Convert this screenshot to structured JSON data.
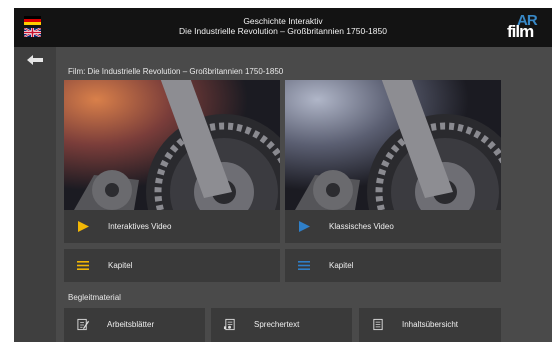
{
  "header": {
    "title_line1": "Geschichte Interaktiv",
    "title_line2": "Die Industrielle Revolution – Großbritannien 1750-1850",
    "logo_text": "film",
    "logo_overlay": "AR"
  },
  "languages": [
    {
      "name": "German",
      "icon": "german-flag-icon"
    },
    {
      "name": "English",
      "icon": "uk-flag-icon"
    }
  ],
  "nav": {
    "back_icon": "back-arrow-icon"
  },
  "film": {
    "title": "Film: Die Industrielle Revolution – Großbritannien 1750-1850"
  },
  "videos": [
    {
      "label": "Interaktives Video",
      "icon": "play-icon",
      "color": "#f2b705"
    },
    {
      "label": "Klassisches Video",
      "icon": "play-icon",
      "color": "#2f7fc8"
    }
  ],
  "chapters": [
    {
      "label": "Kapitel",
      "icon": "list-icon",
      "color": "#f2b705"
    },
    {
      "label": "Kapitel",
      "icon": "list-icon",
      "color": "#2f7fc8"
    }
  ],
  "materials": {
    "section_label": "Begleitmaterial",
    "items": [
      {
        "label": "Arbeitsblätter",
        "icon": "edit-document-icon"
      },
      {
        "label": "Sprechertext",
        "icon": "speaker-text-icon"
      },
      {
        "label": "Inhaltsübersicht",
        "icon": "document-list-icon"
      }
    ]
  }
}
